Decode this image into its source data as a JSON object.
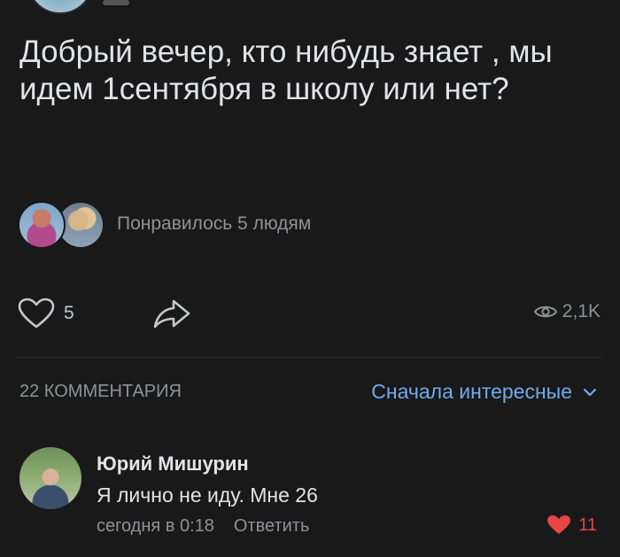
{
  "post": {
    "text": "Добрый вечер, кто нибудь знает , мы идем 1сентября в школу или нет?",
    "likes_summary": "Понравилось 5 людям"
  },
  "actions": {
    "like_count": "5",
    "views": "2,1K",
    "like_icon": "heart-outline-icon",
    "share_icon": "share-arrow-icon",
    "views_icon": "eye-icon"
  },
  "comments": {
    "count_label": "22 КОММЕНТАРИЯ",
    "sort_label": "Сначала интересные",
    "items": [
      {
        "author": "Юрий Мишурин",
        "text": "Я лично не иду. Мне 26",
        "time": "сегодня в 0:18",
        "reply_label": "Ответить",
        "likes": "11"
      }
    ]
  },
  "colors": {
    "background": "#19191a",
    "text": "#e1e3e6",
    "secondary": "#8e9297",
    "accent": "#71aaeb",
    "like_red": "#e64646"
  }
}
